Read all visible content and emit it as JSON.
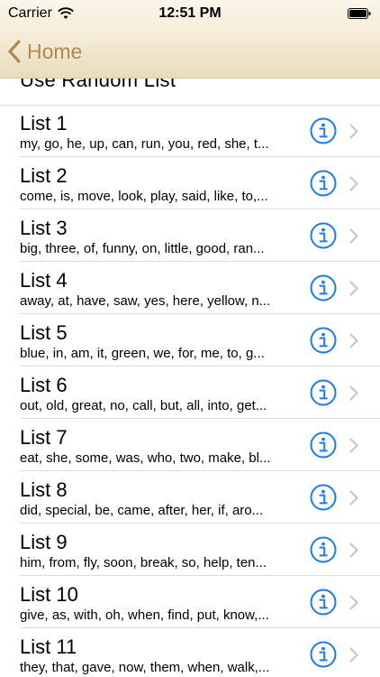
{
  "status_bar": {
    "carrier": "Carrier",
    "time": "12:51 PM"
  },
  "nav": {
    "back_label": "Home"
  },
  "random_row": {
    "label": "Use Random List"
  },
  "lists": [
    {
      "title": "List 1",
      "words": "my, go, he, up, can, run, you, red, she, t..."
    },
    {
      "title": "List 2",
      "words": "come, is, move, look, play, said, like, to,..."
    },
    {
      "title": "List 3",
      "words": "big, three, of, funny, on, little, good, ran..."
    },
    {
      "title": "List 4",
      "words": "away, at, have, saw, yes, here, yellow, n..."
    },
    {
      "title": "List 5",
      "words": "blue, in, am, it, green, we, for, me, to, g..."
    },
    {
      "title": "List 6",
      "words": "out, old, great, no, call, but, all, into, get..."
    },
    {
      "title": "List 7",
      "words": "eat, she, some, was, who, two, make, bl..."
    },
    {
      "title": "List 8",
      "words": "did, special, be, came, after, her, if, aro..."
    },
    {
      "title": "List 9",
      "words": "him, from, fly, soon, break, so, help, ten..."
    },
    {
      "title": "List 10",
      "words": "give, as, with, oh, when, find, put, know,..."
    },
    {
      "title": "List 11",
      "words": "they, that, gave, now, them, when, walk,..."
    }
  ],
  "colors": {
    "accent_blue": "#1a7cf0",
    "back_tint": "#b4874e",
    "chevron_gray": "#c7c7cc"
  },
  "icons": {
    "info": "info-circle-icon",
    "disclosure": "chevron-right-icon",
    "back": "chevron-left-icon"
  }
}
